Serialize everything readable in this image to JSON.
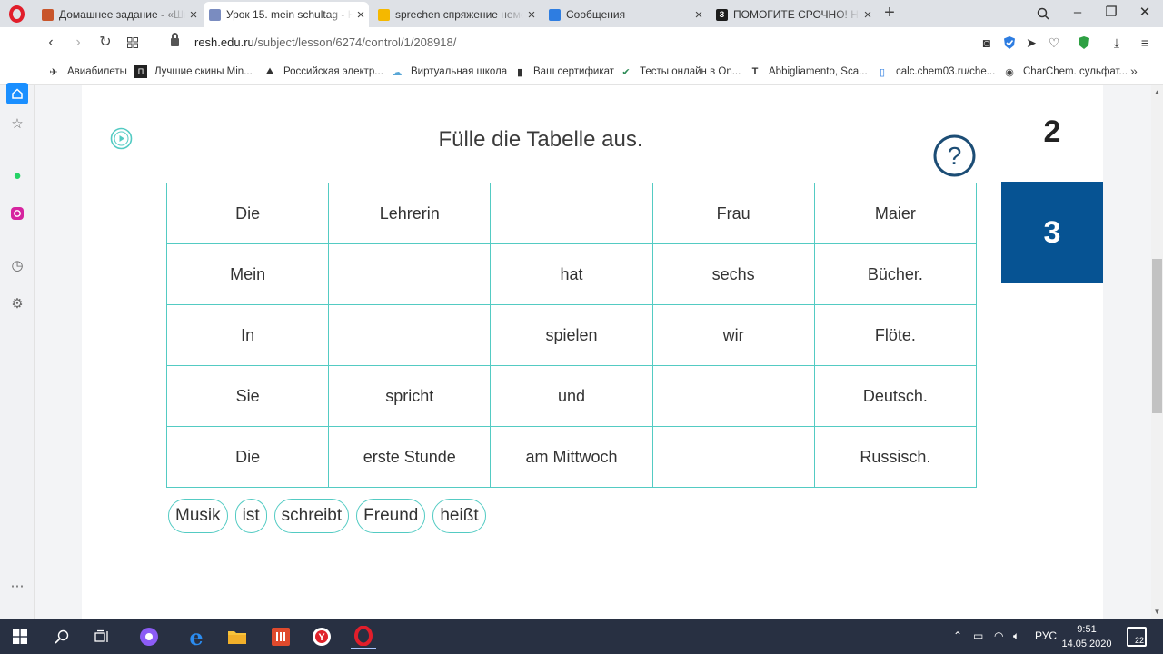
{
  "browser": {
    "tabs": [
      {
        "title": "Домашнее задание - «Шк",
        "favicon_color": "#c8552b",
        "active": false
      },
      {
        "title": "Урок 15. mein schultag - Н",
        "favicon_color": "#7a8cc0",
        "active": true
      },
      {
        "title": "sprechen спряжение неме",
        "favicon_color": "#f5b800",
        "active": false
      },
      {
        "title": "Сообщения",
        "favicon_color": "#2e7de1",
        "active": false
      },
      {
        "title": "ПОМОГИТЕ СРОЧНО! НЕ",
        "favicon_color": "#1c1c1c",
        "favicon_letter": "З",
        "active": false
      }
    ],
    "url_domain": "resh.edu.ru",
    "url_path": "/subject/lesson/6274/control/1/208918/",
    "bookmarks": [
      {
        "label": "Авиабилеты",
        "icon": "airplane-icon"
      },
      {
        "label": "Лучшие скины Min...",
        "icon": "skin-icon"
      },
      {
        "label": "Российская электр...",
        "icon": "school-icon"
      },
      {
        "label": "Виртуальная школа",
        "icon": "cloud-icon"
      },
      {
        "label": "Ваш сертификат",
        "icon": "document-icon"
      },
      {
        "label": "Тесты онлайн в On...",
        "icon": "test-icon"
      },
      {
        "label": "Abbigliamento, Sca...",
        "icon": "t-icon"
      },
      {
        "label": "calc.chem03.ru/che...",
        "icon": "calc-icon"
      },
      {
        "label": "CharChem. сульфат...",
        "icon": "charchem-icon"
      }
    ]
  },
  "exercise": {
    "title": "Fülle die Tabelle aus.",
    "prev_number": "2",
    "current_number": "3",
    "rows": [
      [
        "Die",
        "Lehrerin",
        "",
        "Frau",
        "Maier"
      ],
      [
        "Mein",
        "",
        "hat",
        "sechs",
        "Bücher."
      ],
      [
        "In",
        "",
        "spielen",
        "wir",
        "Flöte."
      ],
      [
        "Sie",
        "spricht",
        "und",
        "",
        "Deutsch."
      ],
      [
        "Die",
        "erste Stunde",
        "am Mittwoch",
        "",
        "Russisch."
      ]
    ],
    "word_bank": [
      "Musik",
      "ist",
      "schreibt",
      "Freund",
      "heißt"
    ]
  },
  "taskbar": {
    "lang": "РУС",
    "time": "9:51",
    "date": "14.05.2020",
    "notifications": "22"
  },
  "colors": {
    "accent_teal": "#53cbc3",
    "active_number_bg": "#065393",
    "help_icon": "#1c4d75",
    "taskbar_bg": "#283042"
  }
}
